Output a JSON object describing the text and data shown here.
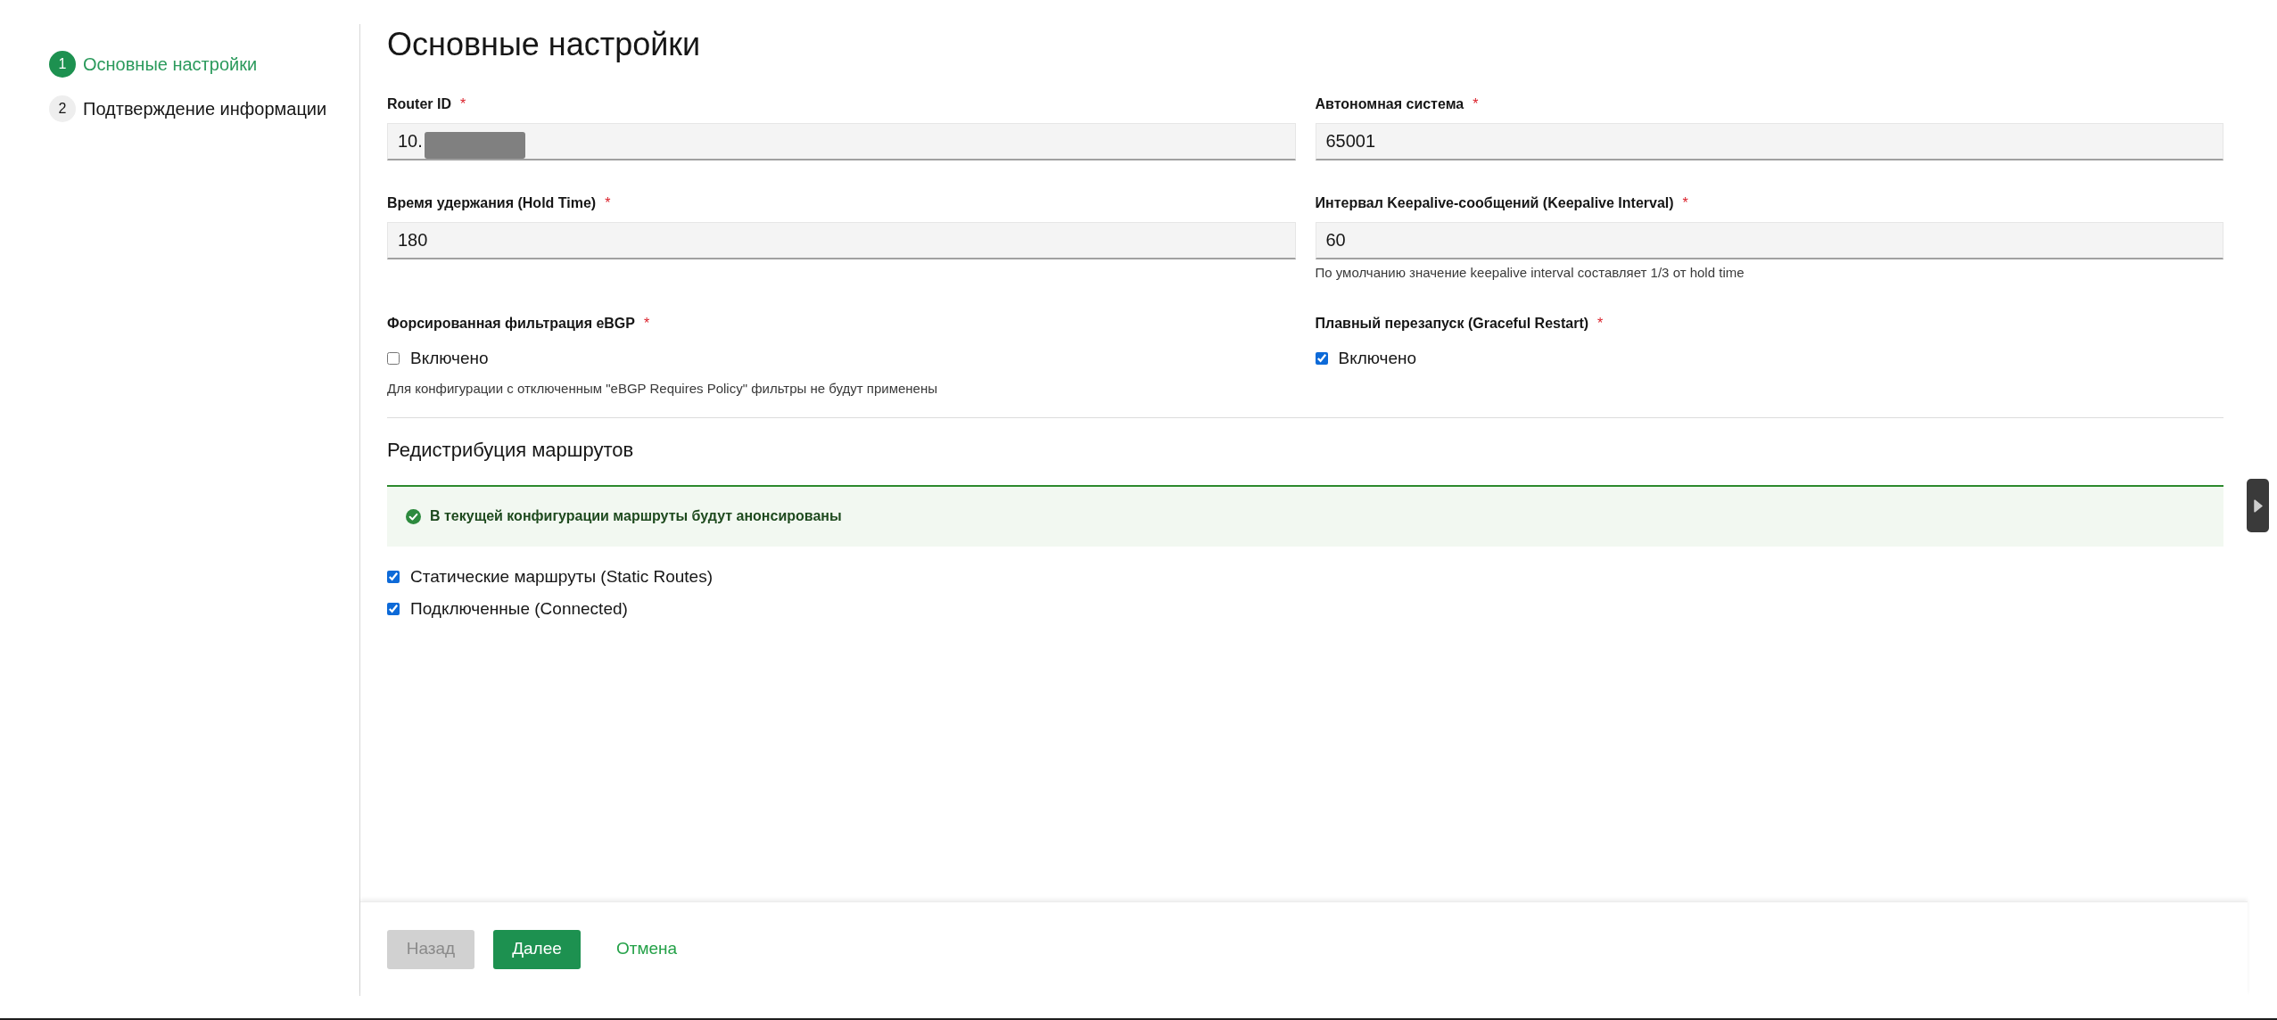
{
  "sidebar": {
    "steps": [
      {
        "number": "1",
        "label": "Основные настройки",
        "selected": true
      },
      {
        "number": "2",
        "label": "Подтверждение информации",
        "selected": false
      }
    ]
  },
  "title": "Основные настройки",
  "fields": [
    {
      "kind": "text",
      "label": "Router ID",
      "required_mark": "*",
      "value": "10.",
      "redacted": true
    },
    {
      "kind": "text",
      "label": "Автономная система",
      "required_mark": "*",
      "value": "65001"
    },
    {
      "kind": "text",
      "label": "Время удержания (Hold Time)",
      "required_mark": "*",
      "value": "180"
    },
    {
      "kind": "text",
      "label": "Интервал Keepalive-сообщений (Keepalive Interval)",
      "required_mark": "*",
      "value": "60",
      "help": "По умолчанию значение keepalive interval составляет 1/3 от hold time"
    },
    {
      "kind": "checkbox",
      "label": "Форсированная фильтрация eBGP",
      "required_mark": "*",
      "option": "Включено",
      "checked": false,
      "help": "Для конфигурации с отключенным \"eBGP Requires Policy\" фильтры не будут применены"
    },
    {
      "kind": "checkbox",
      "label": "Плавный перезапуск (Graceful Restart)",
      "required_mark": "*",
      "option": "Включено",
      "checked": true
    }
  ],
  "redistribution": {
    "title": "Редистрибуция маршрутов",
    "alert": {
      "kind": "success",
      "text": "В текущей конфигурации маршруты будут анонсированы"
    },
    "options": [
      {
        "label": "Статические маршруты (Static Routes)",
        "checked": true
      },
      {
        "label": "Подключенные (Connected)",
        "checked": true
      }
    ]
  },
  "footer": {
    "buttons": [
      {
        "kind": "secondary",
        "label": "Назад",
        "disabled": true
      },
      {
        "kind": "primary",
        "label": "Далее",
        "disabled": false
      },
      {
        "kind": "link",
        "label": "Отмена",
        "disabled": false
      }
    ]
  }
}
